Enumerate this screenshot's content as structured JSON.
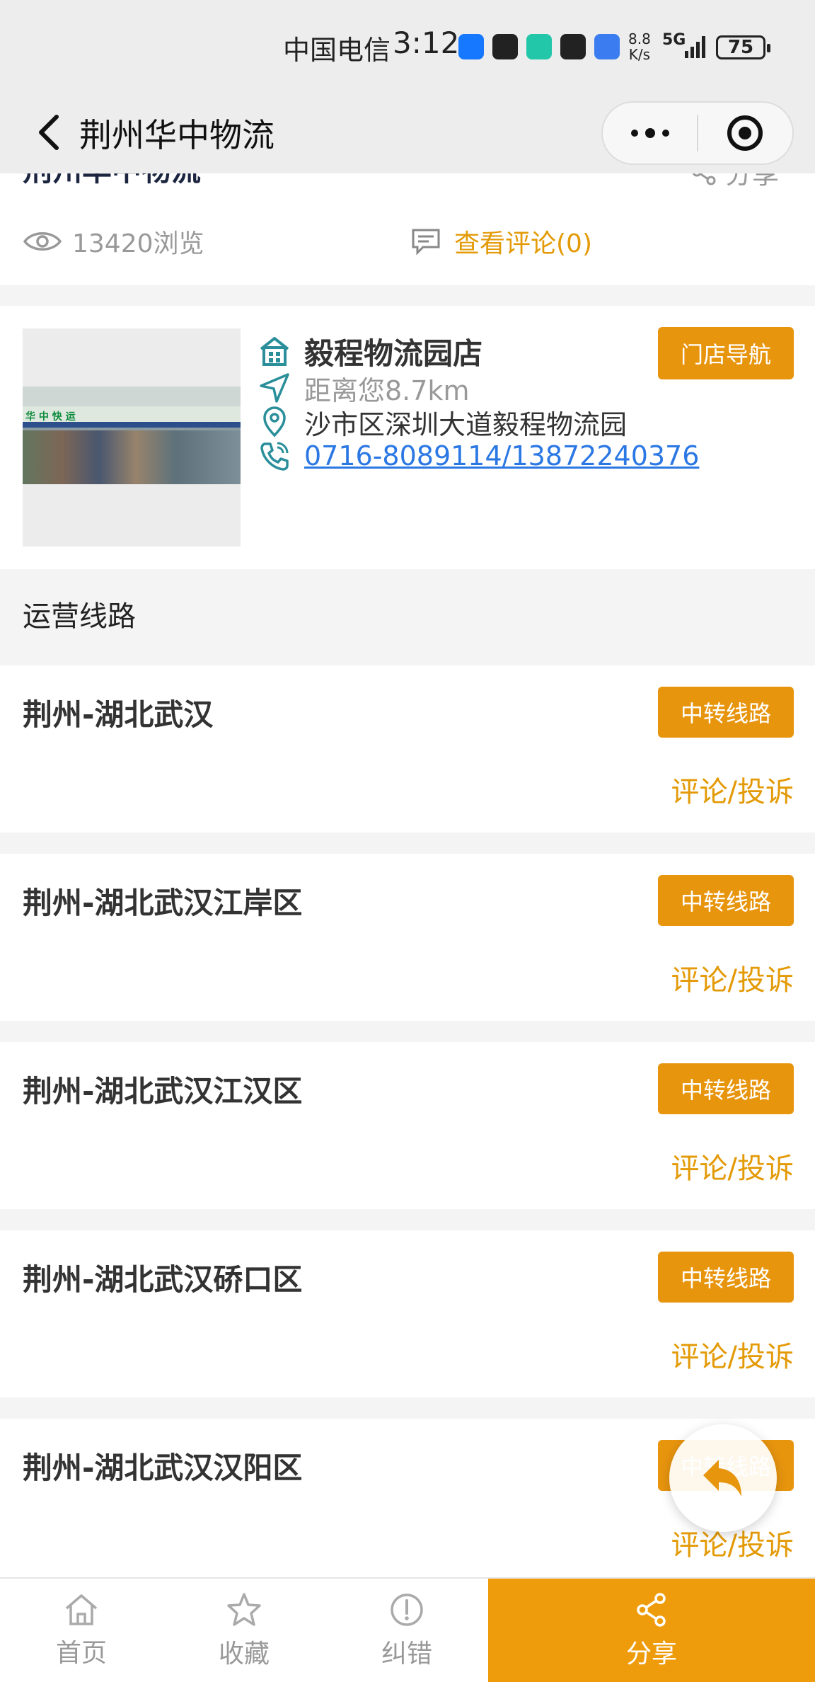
{
  "status_bar": {
    "carrier": "中国电信",
    "time": "3:12",
    "speed_value": "8.8",
    "speed_unit": "K/s",
    "network": "5G",
    "battery": "75"
  },
  "nav": {
    "title": "荆州华中物流"
  },
  "header": {
    "shop_title": "荆州华中物流",
    "share_label": "分享",
    "views": "13420浏览",
    "comments": "查看评论(0)"
  },
  "store": {
    "name": "毅程物流园店",
    "distance": "距离您8.7km",
    "address": "沙市区深圳大道毅程物流园",
    "phone": "0716-8089114/13872240376",
    "nav_button": "门店导航",
    "image_sign": "华 中 快 运"
  },
  "section_title": "运营线路",
  "routes": [
    {
      "name": "荆州-湖北武汉",
      "tag": "中转线路",
      "action": "评论/投诉"
    },
    {
      "name": "荆州-湖北武汉江岸区",
      "tag": "中转线路",
      "action": "评论/投诉"
    },
    {
      "name": "荆州-湖北武汉江汉区",
      "tag": "中转线路",
      "action": "评论/投诉"
    },
    {
      "name": "荆州-湖北武汉硚口区",
      "tag": "中转线路",
      "action": "评论/投诉"
    },
    {
      "name": "荆州-湖北武汉汉阳区",
      "tag": "中转线路",
      "action": "评论/投诉"
    }
  ],
  "tabs": {
    "home": "首页",
    "favorite": "收藏",
    "report": "纠错",
    "share": "分享"
  },
  "colors": {
    "accent": "#e8950e",
    "link": "#2b78e4",
    "icon_teal": "#2a8f9a"
  }
}
